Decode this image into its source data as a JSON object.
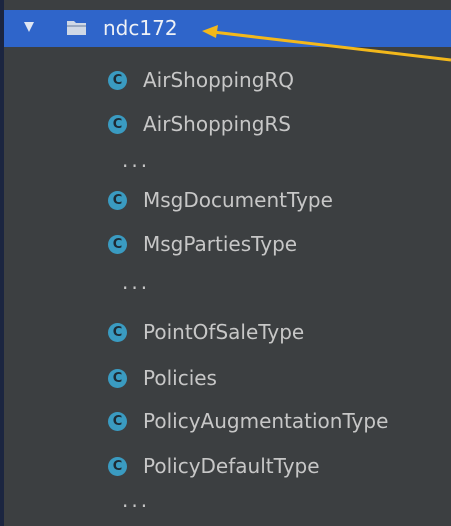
{
  "tree": {
    "folder": {
      "label": "ndc172",
      "expanded": true,
      "icon": "folder-icon",
      "toggle_icon": "expand-triangle-icon"
    },
    "class_icon_letter": "C",
    "groups": [
      {
        "items": [
          "AirShoppingRQ",
          "AirShoppingRS"
        ],
        "ellipsis": "..."
      },
      {
        "items": [
          "MsgDocumentType",
          "MsgPartiesType"
        ],
        "ellipsis": "..."
      },
      {
        "items": [
          "PointOfSaleType",
          "Policies",
          "PolicyAugmentationType",
          "PolicyDefaultType"
        ],
        "ellipsis": "..."
      }
    ]
  },
  "colors": {
    "background": "#1b2540",
    "panel": "#3c3f41",
    "selection": "#2f65ca",
    "class_icon": "#3a9bc1",
    "callout_arrow": "#f3b81b"
  }
}
